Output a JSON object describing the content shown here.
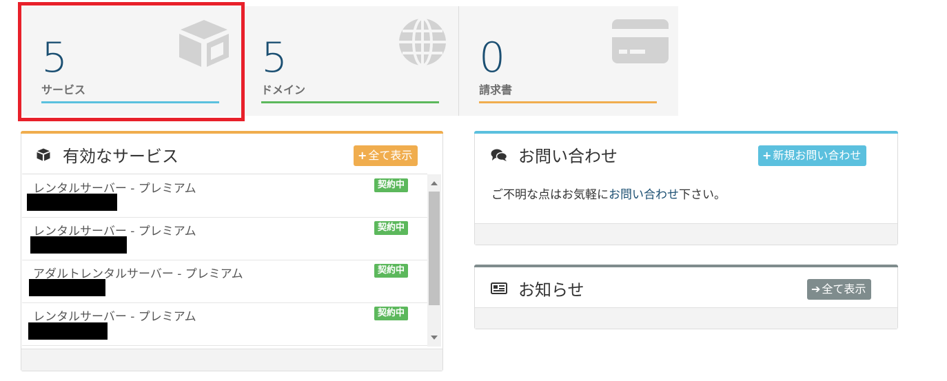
{
  "stats": [
    {
      "count": "5",
      "label": "サービス",
      "icon": "cube-icon",
      "accent": "#5bc0de"
    },
    {
      "count": "5",
      "label": "ドメイン",
      "icon": "globe-icon",
      "accent": "#5cb85c"
    },
    {
      "count": "0",
      "label": "請求書",
      "icon": "credit-card-icon",
      "accent": "#f0ad4e"
    }
  ],
  "services_panel": {
    "title": "有効なサービス",
    "view_all_label": "全て表示",
    "accent": "#f0ad4e",
    "items": [
      {
        "name": "レンタルサーバー - プレミアム",
        "status": "契約中"
      },
      {
        "name": "レンタルサーバー - プレミアム",
        "status": "契約中"
      },
      {
        "name": "アダルトレンタルサーバー - プレミアム",
        "status": "契約中"
      },
      {
        "name": "レンタルサーバー - プレミアム",
        "status": "契約中"
      }
    ]
  },
  "contact_panel": {
    "title": "お問い合わせ",
    "new_button_label": "新規お問い合わせ",
    "text_before": "ご不明な点はお気軽に",
    "link_text": "お問い合わせ",
    "text_after": "下さい。",
    "accent": "#5bc0de"
  },
  "news_panel": {
    "title": "お知らせ",
    "view_all_label": "全て表示",
    "accent": "#7f8c8d"
  }
}
